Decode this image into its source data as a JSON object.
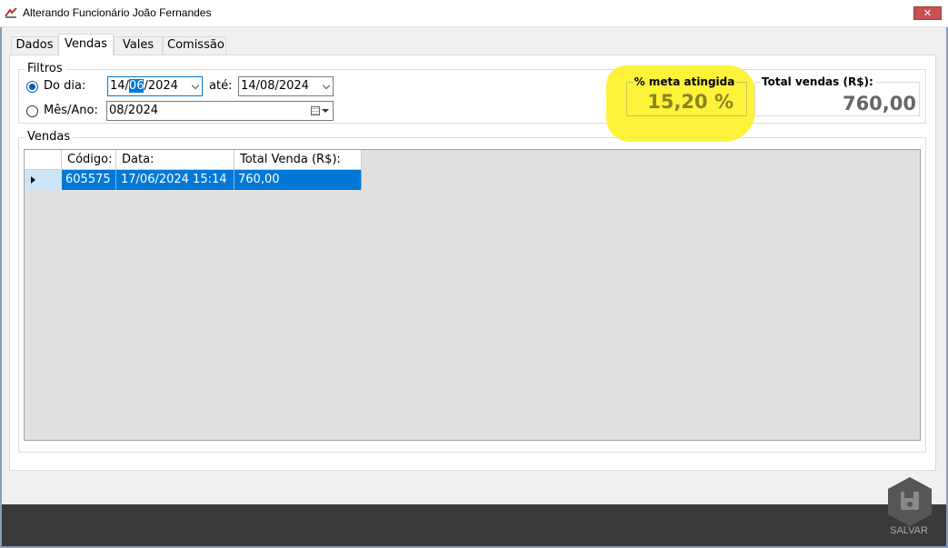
{
  "window": {
    "title": "Alterando Funcionário João Fernandes",
    "close_label": "✕"
  },
  "tabs": [
    {
      "label": "Dados"
    },
    {
      "label": "Vendas"
    },
    {
      "label": "Vales"
    },
    {
      "label": "Comissão"
    }
  ],
  "filters": {
    "group_title": "Filtros",
    "do_dia": {
      "label": "Do dia:",
      "checked": true,
      "from_day": "14/",
      "from_month_selected": "06",
      "from_year": "/2024",
      "ate_label": "até:",
      "to_value": "14/08/2024"
    },
    "mes_ano": {
      "label": "Mês/Ano:",
      "checked": false,
      "value": "08/2024"
    }
  },
  "stats": {
    "meta": {
      "label": "% meta atingida",
      "value": "15,20 %"
    },
    "total": {
      "label": "Total vendas (R$):",
      "value": "760,00"
    }
  },
  "sales": {
    "group_title": "Vendas",
    "columns": [
      "Código:",
      "Data:",
      "Total Venda (R$):"
    ],
    "rows": [
      {
        "codigo": "605575",
        "data": "17/06/2024 15:14",
        "total": "760,00"
      }
    ]
  },
  "footer": {
    "save_label": "SALVAR"
  },
  "colors": {
    "accent": "#0078d7",
    "highlight": "#fdf33a",
    "footer": "#3a3a3a"
  }
}
